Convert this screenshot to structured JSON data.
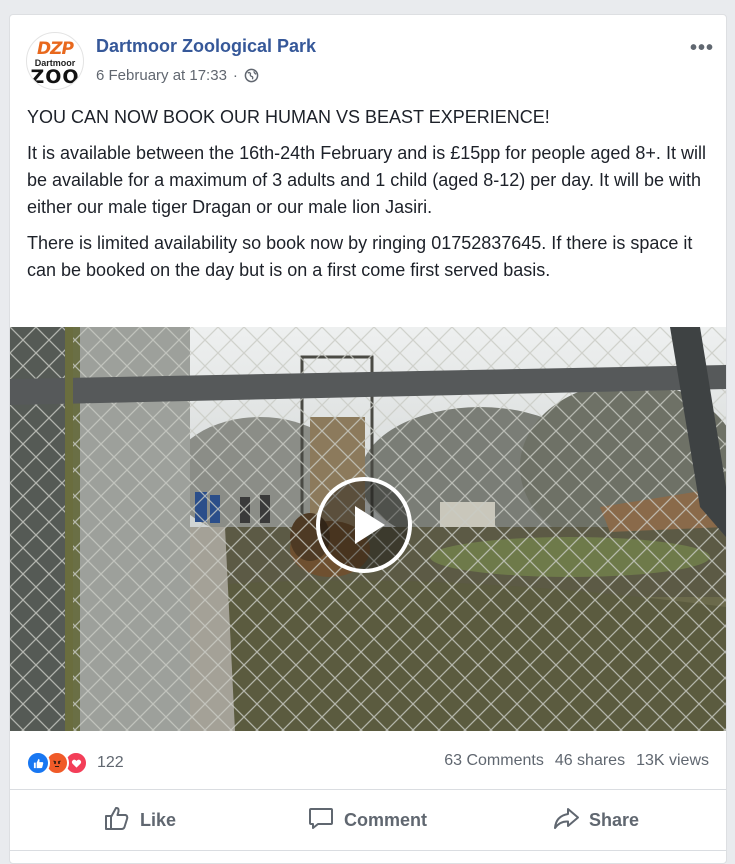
{
  "post": {
    "page_name": "Dartmoor Zoological Park",
    "timestamp": "6 February at 17:33",
    "separator": "·",
    "privacy_icon": "globe-icon",
    "more_label": "•••",
    "avatar": {
      "logo_top": "DZP",
      "logo_mid": "Dartmoor",
      "logo_bottom": "ZOO"
    },
    "paragraphs": [
      "YOU CAN NOW BOOK OUR HUMAN VS BEAST EXPERIENCE!",
      "It is available between the 16th-24th February and is £15pp for people aged 8+. It will be available for a maximum of 3 adults and 1 child (aged 8-12) per day. It will be with either our male tiger Dragan or our male lion Jasiri.",
      "There is limited availability so book now by ringing 01752837645. If there is space it can be booked on the day but is on a first come first served basis."
    ]
  },
  "video": {
    "play_icon": "play-icon"
  },
  "stats": {
    "reaction_count": "122",
    "reaction_icons": [
      "like-reaction-icon",
      "angry-reaction-icon",
      "love-reaction-icon"
    ],
    "comments": "63 Comments",
    "shares": "46 shares",
    "views": "13K views"
  },
  "actions": {
    "like": "Like",
    "comment": "Comment",
    "share": "Share"
  },
  "colors": {
    "link_blue": "#365899",
    "like_blue": "#1877f2",
    "angry_orange": "#f05a28",
    "love_red": "#f33e58"
  }
}
